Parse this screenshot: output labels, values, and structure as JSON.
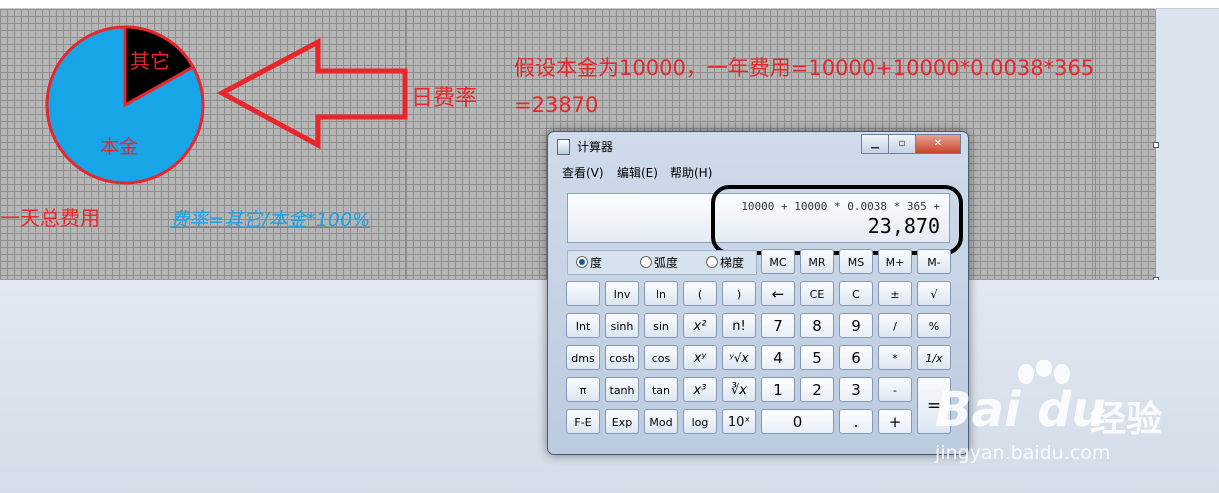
{
  "annotation": {
    "pie_segment_other": "其它",
    "pie_segment_principal": "本金",
    "daily_rate_label": "日费率",
    "daily_total_label": "一天总费用",
    "formula": "费率=其它/本金*100%",
    "assumption_line1": "假设本金为10000，一年费用=10000+10000*0.0038*365",
    "assumption_line2": "=23870"
  },
  "calculator": {
    "title": "计算器",
    "menu": [
      "查看(V)",
      "编辑(E)",
      "帮助(H)"
    ],
    "expression": "10000 + 10000 * 0.0038 * 365 +",
    "result": "23,870",
    "angle_modes": [
      "度",
      "弧度",
      "梯度"
    ],
    "memory": [
      "MC",
      "MR",
      "MS",
      "M+",
      "M-"
    ],
    "row1": [
      "",
      "Inv",
      "ln",
      "(",
      ")",
      "←",
      "CE",
      "C",
      "±",
      "√"
    ],
    "row2": [
      "Int",
      "sinh",
      "sin",
      "x²",
      "n!",
      "7",
      "8",
      "9",
      "/",
      "%"
    ],
    "row3": [
      "dms",
      "cosh",
      "cos",
      "xʸ",
      "ʸ√x",
      "4",
      "5",
      "6",
      "*",
      "1/x"
    ],
    "row4": [
      "π",
      "tanh",
      "tan",
      "x³",
      "∛x",
      "1",
      "2",
      "3",
      "-",
      "="
    ],
    "row5": [
      "F-E",
      "Exp",
      "Mod",
      "log",
      "10ˣ",
      "0",
      ".",
      "+"
    ]
  },
  "watermark": {
    "brand": "Bai du",
    "cn": "经验",
    "url": "jingyan.baidu.com"
  },
  "colors": {
    "annotation_red": "#e8262c",
    "pie_blue": "#18a5e8",
    "formula_blue": "#1aa3e6"
  }
}
